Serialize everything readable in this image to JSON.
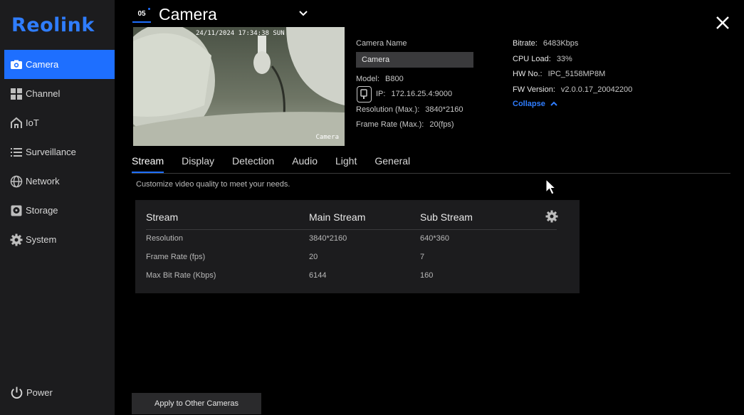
{
  "brand": "Reolink",
  "accent_color": "#1e6fff",
  "sidebar": {
    "items": [
      {
        "label": "Camera",
        "icon": "camera-icon",
        "active": true
      },
      {
        "label": "Channel",
        "icon": "grid-icon",
        "active": false
      },
      {
        "label": "IoT",
        "icon": "home-icon",
        "active": false
      },
      {
        "label": "Surveillance",
        "icon": "list-icon",
        "active": false
      },
      {
        "label": "Network",
        "icon": "globe-icon",
        "active": false
      },
      {
        "label": "Storage",
        "icon": "storage-icon",
        "active": false
      },
      {
        "label": "System",
        "icon": "gear-icon",
        "active": false
      }
    ],
    "power_label": "Power"
  },
  "header": {
    "channel_number": "05",
    "title": "Camera"
  },
  "preview": {
    "timestamp": "24/11/2024 17:34:38 SUN",
    "osd_name": "Camera"
  },
  "camera_info": {
    "name_label": "Camera Name",
    "name_value": "Camera",
    "model_label": "Model:",
    "model_value": "B800",
    "ip_label": "IP:",
    "ip_value": "172.16.25.4:9000",
    "resolution_label": "Resolution (Max.):",
    "resolution_value": "3840*2160",
    "framerate_label": "Frame Rate (Max.):",
    "framerate_value": "20(fps)",
    "bitrate_label": "Bitrate:",
    "bitrate_value": "6483Kbps",
    "cpu_label": "CPU Load:",
    "cpu_value": "33%",
    "hw_label": "HW No.:",
    "hw_value": "IPC_5158MP8M",
    "fw_label": "FW Version:",
    "fw_value": "v2.0.0.17_20042200",
    "collapse_label": "Collapse"
  },
  "tabs": [
    "Stream",
    "Display",
    "Detection",
    "Audio",
    "Light",
    "General"
  ],
  "active_tab": "Stream",
  "description": "Customize video quality to meet your needs.",
  "stream_table": {
    "headers": [
      "Stream",
      "Main Stream",
      "Sub Stream"
    ],
    "rows": [
      {
        "label": "Resolution",
        "main": "3840*2160",
        "sub": "640*360"
      },
      {
        "label": "Frame Rate (fps)",
        "main": "20",
        "sub": "7"
      },
      {
        "label": "Max Bit Rate (Kbps)",
        "main": "6144",
        "sub": "160"
      }
    ]
  },
  "apply_button": "Apply to Other Cameras"
}
